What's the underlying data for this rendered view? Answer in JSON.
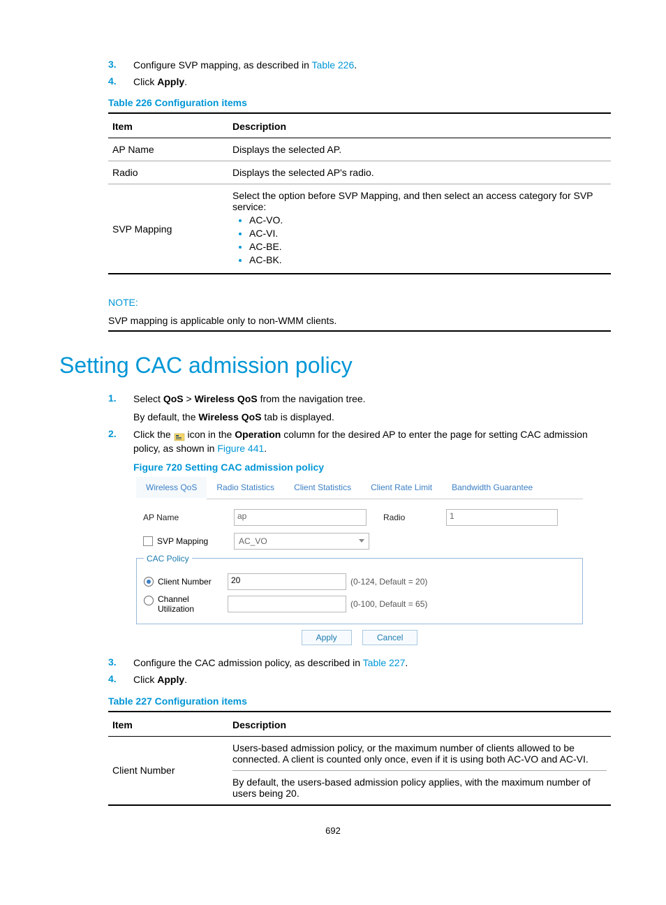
{
  "step3_top": {
    "num": "3.",
    "text_before": "Configure SVP mapping, as described in ",
    "link": "Table 226",
    "text_after": "."
  },
  "step4_top": {
    "num": "4.",
    "text_before": "Click ",
    "bold": "Apply",
    "text_after": "."
  },
  "table226": {
    "caption": "Table 226 Configuration items",
    "col_item": "Item",
    "col_desc": "Description",
    "rows": [
      {
        "item": "AP Name",
        "desc": "Displays the selected AP."
      },
      {
        "item": "Radio",
        "desc": "Displays the selected AP's radio."
      }
    ],
    "row3": {
      "item": "SVP Mapping",
      "desc_intro": "Select the option before SVP Mapping, and then select an access category for SVP service:",
      "bullets": [
        "AC-VO.",
        "AC-VI.",
        "AC-BE.",
        "AC-BK."
      ]
    }
  },
  "note": {
    "label": "NOTE:",
    "body": "SVP mapping is applicable only to non-WMM clients."
  },
  "section_title": "Setting CAC admission policy",
  "step1": {
    "num": "1.",
    "text1": "Select ",
    "bold1": "QoS",
    "sep": " > ",
    "bold2": "Wireless QoS",
    "text2": " from the navigation tree.",
    "sub1_a": "By default, the ",
    "sub1_bold": "Wireless QoS",
    "sub1_b": " tab is displayed."
  },
  "step2": {
    "num": "2.",
    "text1": "Click the ",
    "text2": " icon in the ",
    "bold1": "Operation",
    "text3": " column for the desired AP to enter the page for setting CAC admission policy, as shown in ",
    "link": "Figure 441",
    "text4": "."
  },
  "figure": {
    "caption": "Figure 720 Setting CAC admission policy",
    "tabs": [
      "Wireless QoS",
      "Radio Statistics",
      "Client Statistics",
      "Client Rate Limit",
      "Bandwidth Guarantee"
    ],
    "ap_name_label": "AP Name",
    "ap_name_value": "ap",
    "radio_label": "Radio",
    "radio_value": "1",
    "svp_label": "SVP Mapping",
    "svp_value": "AC_VO",
    "cac_legend": "CAC Policy",
    "client_number_label": "Client Number",
    "client_number_value": "20",
    "client_number_hint": "(0-124, Default = 20)",
    "channel_label": "Channel Utilization",
    "channel_value": "",
    "channel_hint": "(0-100, Default = 65)",
    "apply": "Apply",
    "cancel": "Cancel"
  },
  "step3_bot": {
    "num": "3.",
    "text_before": "Configure the CAC admission policy, as described in ",
    "link": "Table 227",
    "text_after": "."
  },
  "step4_bot": {
    "num": "4.",
    "text_before": "Click ",
    "bold": "Apply",
    "text_after": "."
  },
  "table227": {
    "caption": "Table 227 Configuration items",
    "col_item": "Item",
    "col_desc": "Description",
    "row": {
      "item": "Client Number",
      "para1": "Users-based admission policy, or the maximum number of clients allowed to be connected. A client is counted only once, even if it is using both AC-VO and AC-VI.",
      "para2": "By default, the users-based admission policy applies, with the maximum number of users being 20."
    }
  },
  "page_number": "692"
}
